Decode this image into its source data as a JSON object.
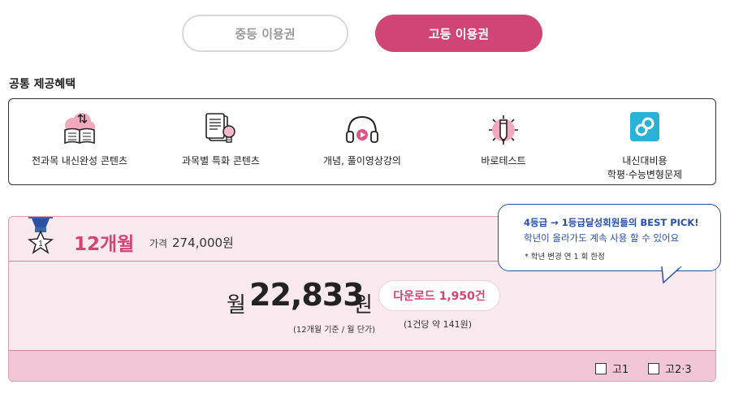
{
  "tabs": {
    "middle": "중등 이용권",
    "high": "고등 이용권"
  },
  "benefits": {
    "title": "공통 제공혜택",
    "items": [
      {
        "label": "전과목 내신완성 콘텐츠",
        "icon": "cloud-book-icon"
      },
      {
        "label": "과목별 특화 콘텐츠",
        "icon": "document-lightbulb-icon"
      },
      {
        "label": "개념, 풀이영상강의",
        "icon": "headphones-play-icon"
      },
      {
        "label": "바로테스트",
        "icon": "pencil-target-icon"
      },
      {
        "label": "내신대비용\n학평·수능변형문제",
        "icon": "link-icon"
      }
    ]
  },
  "plan": {
    "period": "12개월",
    "price_label": "가격",
    "price": "274,000원",
    "monthly_prefix": "월",
    "monthly_amount": "22,833",
    "monthly_suffix": "원",
    "monthly_note": "(12개월 기준 / 월 단가)",
    "download": "다운로드 1,950건",
    "download_note": "(1건당 약 141원)",
    "medal_number": "1",
    "grades": [
      "고1",
      "고2·3"
    ]
  },
  "bubble": {
    "line1": "4등급 → 1등급달성회원들의 BEST PICK!",
    "line2": "학년이 올라가도 계속 사용 할 수 있어요",
    "line3": "* 학년 변경 연 1 회 한정"
  },
  "colors": {
    "accent": "#d04575",
    "plan_bg": "#fbe9f0",
    "plan_foot_bg": "#f1c6d6",
    "bubble_blue": "#2a4fa3"
  }
}
